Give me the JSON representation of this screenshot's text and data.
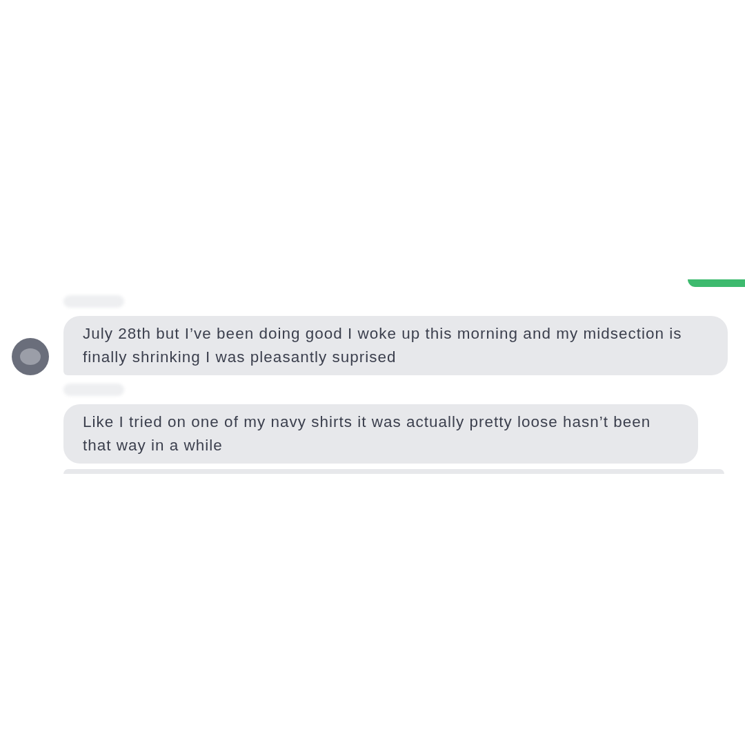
{
  "thread": {
    "outgoing_partial": true,
    "messages": [
      {
        "kind": "text",
        "sender_redacted": true,
        "avatar": true,
        "text": "July 28th but I’ve been doing good I woke up this morning and my midsection is finally shrinking I was pleasantly suprised"
      },
      {
        "kind": "text",
        "sender_redacted": true,
        "avatar": false,
        "text": "Like I tried on one of my navy shirts it was actually pretty loose hasn’t been that way in a while"
      },
      {
        "kind": "partial",
        "sender_redacted": false,
        "avatar": false
      }
    ]
  }
}
